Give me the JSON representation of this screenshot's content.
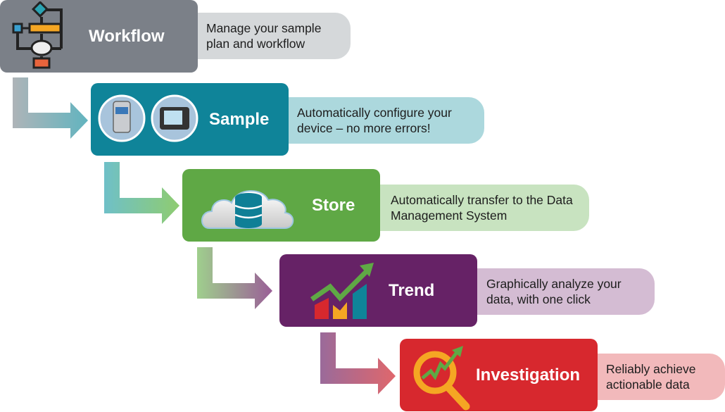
{
  "steps": [
    {
      "title": "Workflow",
      "description": "Manage your sample plan and workflow",
      "icon": "workflow-flowchart-icon",
      "color": "#7b8088",
      "desc_color": "#d5d8da"
    },
    {
      "title": "Sample",
      "description": "Automatically configure your device – no more errors!",
      "icon": "sampler-devices-icon",
      "color": "#0f8499",
      "desc_color": "#acd8dd"
    },
    {
      "title": "Store",
      "description": "Automatically transfer to the Data Management System",
      "icon": "cloud-database-icon",
      "color": "#5fa845",
      "desc_color": "#c8e3c0"
    },
    {
      "title": "Trend",
      "description": "Graphically analyze your data, with one click",
      "icon": "trend-chart-icon",
      "color": "#662266",
      "desc_color": "#d4bcd3"
    },
    {
      "title": "Investigation",
      "description": "Reliably achieve actionable data",
      "icon": "magnifier-trend-icon",
      "color": "#d7282e",
      "desc_color": "#f2b9bb"
    }
  ]
}
